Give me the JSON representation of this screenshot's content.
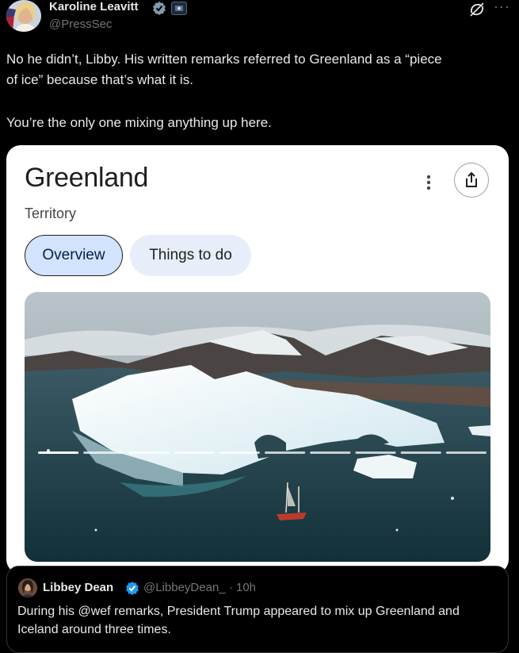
{
  "author": {
    "name": "Karoline Leavitt",
    "handle": "@PressSec",
    "avatar": "avatar"
  },
  "header_icons": {
    "grok": "grok-icon",
    "more": "···"
  },
  "tweet": {
    "line1": "No he didn’t, Libby. His written remarks referred to Greenland as a “piece",
    "line2": "of ice” because that’s what it is.",
    "line3": "You’re the only one mixing anything up here."
  },
  "card": {
    "title": "Greenland",
    "subtitle": "Territory",
    "tabs": [
      "Overview",
      "Things to do"
    ],
    "active_tab": "Overview",
    "progress_segments": 10,
    "progress_active_index": 0,
    "colors": {
      "active_chip": "#d3e3fd",
      "inactive_chip": "#e8eef9"
    }
  },
  "quote": {
    "name": "Libbey Dean",
    "handle": "@LibbeyDean_",
    "time": "· 10h",
    "line1": "During his @wef remarks, President Trump appeared to mix up Greenland and",
    "line2": "Iceland around three times."
  },
  "colors": {
    "background": "#000000",
    "verified": "#1d9bf0",
    "secondary_text": "#71767b"
  }
}
